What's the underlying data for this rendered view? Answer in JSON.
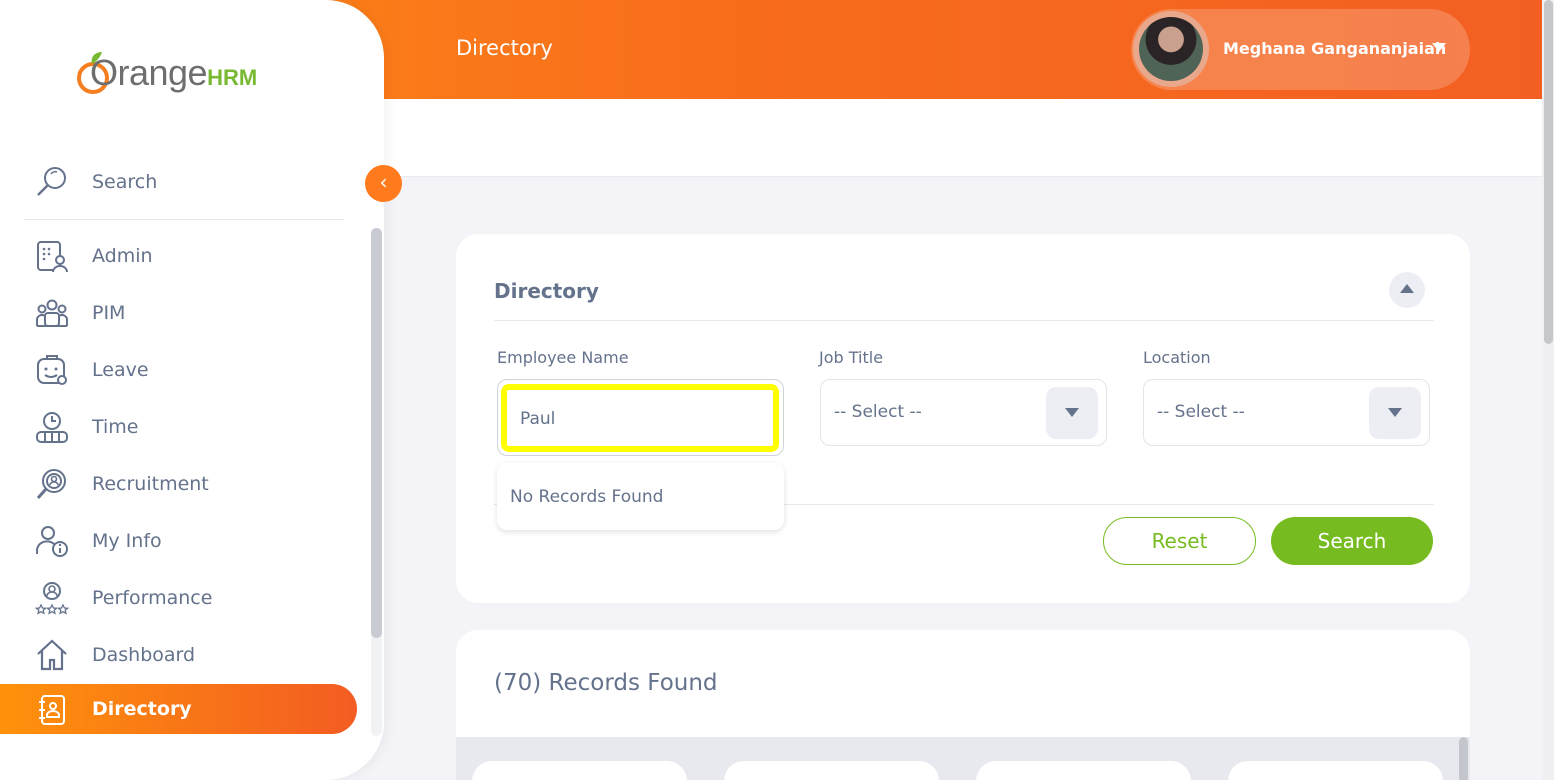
{
  "topbar": {
    "title": "Directory",
    "user_name": "Meghana Gangananjaiah"
  },
  "brand": {
    "logo_main": "Orange",
    "logo_suffix": "HRM",
    "accent": "#ff7b1d",
    "green": "#76bc21"
  },
  "sidebar": {
    "search_label": "Search",
    "items": [
      {
        "label": "Admin",
        "icon": "admin-icon"
      },
      {
        "label": "PIM",
        "icon": "pim-icon"
      },
      {
        "label": "Leave",
        "icon": "leave-icon"
      },
      {
        "label": "Time",
        "icon": "time-icon"
      },
      {
        "label": "Recruitment",
        "icon": "recruitment-icon"
      },
      {
        "label": "My Info",
        "icon": "my-info-icon"
      },
      {
        "label": "Performance",
        "icon": "performance-icon"
      },
      {
        "label": "Dashboard",
        "icon": "dashboard-icon"
      },
      {
        "label": "Directory",
        "icon": "directory-icon",
        "active": true
      }
    ],
    "toggle_glyph": "‹"
  },
  "filter": {
    "title": "Directory",
    "employee_name": {
      "label": "Employee Name",
      "value": "Paul"
    },
    "job_title": {
      "label": "Job Title",
      "selected": "-- Select --"
    },
    "location": {
      "label": "Location",
      "selected": "-- Select --"
    },
    "autocomplete_message": "No Records Found",
    "reset_label": "Reset",
    "search_label": "Search"
  },
  "records": {
    "summary": "(70) Records Found"
  }
}
